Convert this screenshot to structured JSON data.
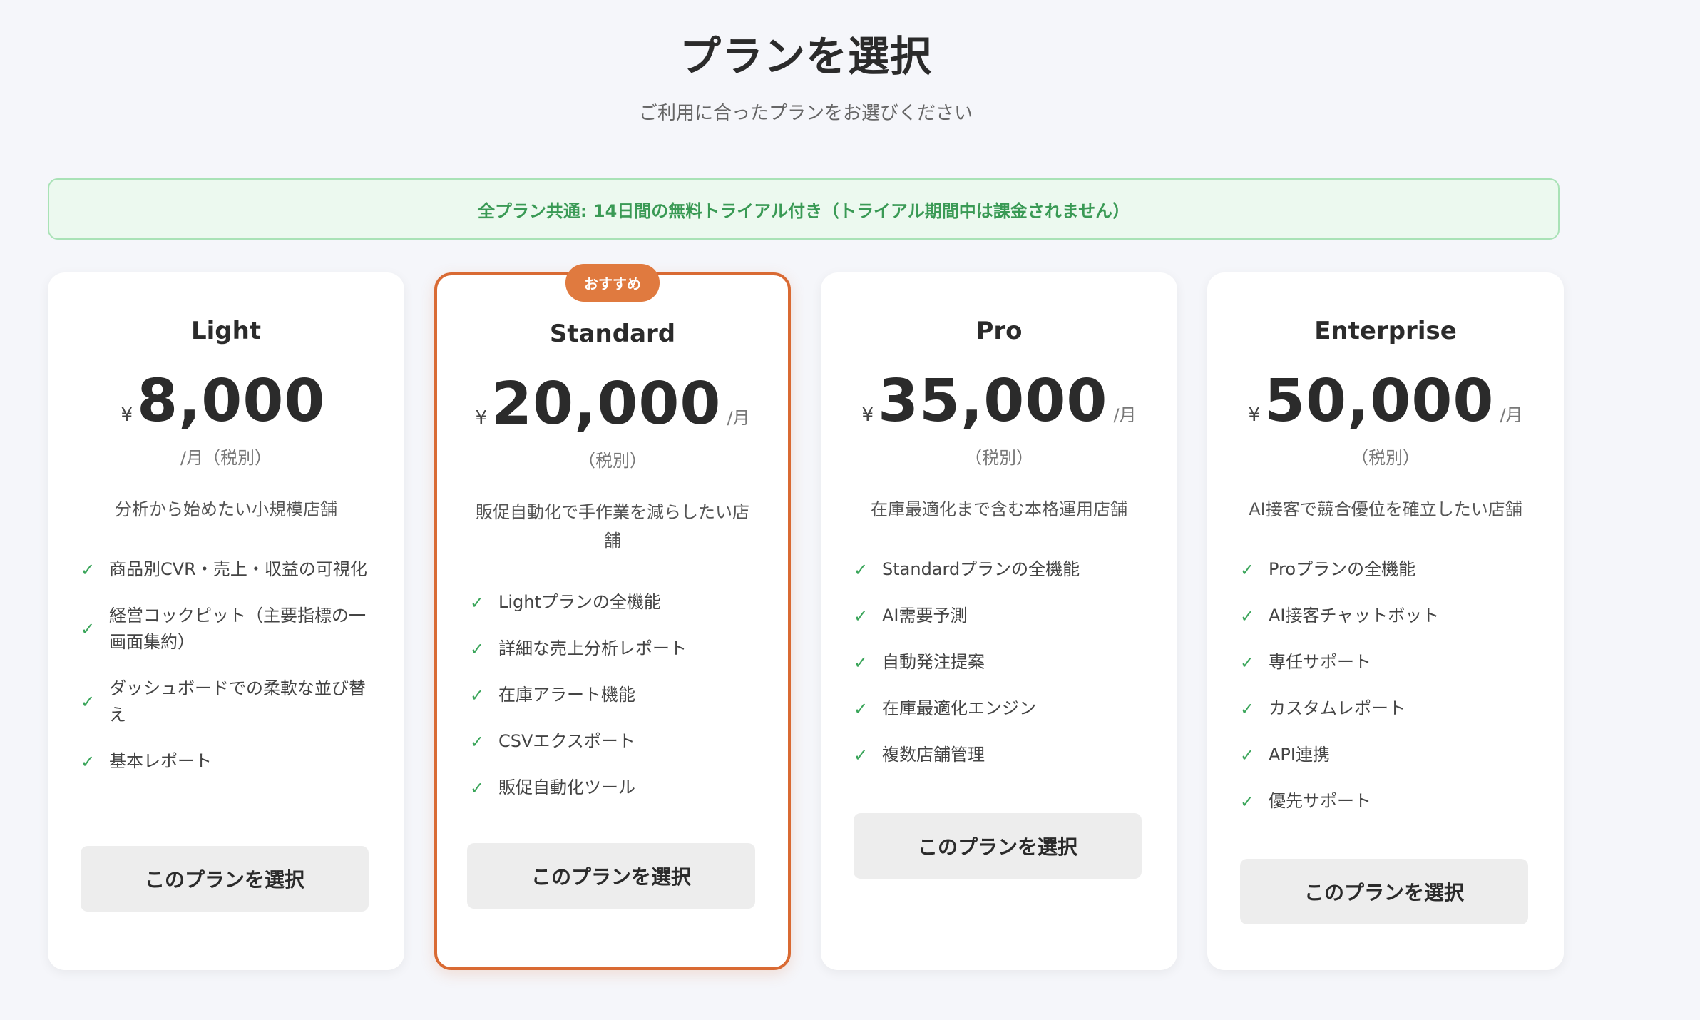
{
  "header": {
    "title": "プランを選択",
    "subtitle": "ご利用に合ったプランをお選びください"
  },
  "trial_notice": "全プラン共通: 14日間の無料トライアル付き（トライアル期間中は課金されません）",
  "colors": {
    "accent": "#d96a33",
    "badge": "#e07a3f",
    "check": "#3aa55a",
    "trial_text": "#3a9a55",
    "trial_bg": "#ecf9ef"
  },
  "plans": [
    {
      "name": "Light",
      "currency": "¥",
      "price": "8,000",
      "per": "",
      "tax": "/月（税別）",
      "description": "分析から始めたい小規模店舗",
      "features": [
        "商品別CVR・売上・収益の可視化",
        "経営コックピット（主要指標の一画面集約）",
        "ダッシュボードでの柔軟な並び替え",
        "基本レポート"
      ],
      "button": "このプランを選択"
    },
    {
      "name": "Standard",
      "badge": "おすすめ",
      "currency": "¥",
      "price": "20,000",
      "per": "/月",
      "tax": "（税別）",
      "description": "販促自動化で手作業を減らしたい店舗",
      "features": [
        "Lightプランの全機能",
        "詳細な売上分析レポート",
        "在庫アラート機能",
        "CSVエクスポート",
        "販促自動化ツール"
      ],
      "button": "このプランを選択"
    },
    {
      "name": "Pro",
      "currency": "¥",
      "price": "35,000",
      "per": "/月",
      "tax": "（税別）",
      "description": "在庫最適化まで含む本格運用店舗",
      "features": [
        "Standardプランの全機能",
        "AI需要予測",
        "自動発注提案",
        "在庫最適化エンジン",
        "複数店舗管理"
      ],
      "button": "このプランを選択"
    },
    {
      "name": "Enterprise",
      "currency": "¥",
      "price": "50,000",
      "per": "/月",
      "tax": "（税別）",
      "description": "AI接客で競合優位を確立したい店舗",
      "features": [
        "Proプランの全機能",
        "AI接客チャットボット",
        "専任サポート",
        "カスタムレポート",
        "API連携",
        "優先サポート"
      ],
      "button": "このプランを選択"
    }
  ]
}
